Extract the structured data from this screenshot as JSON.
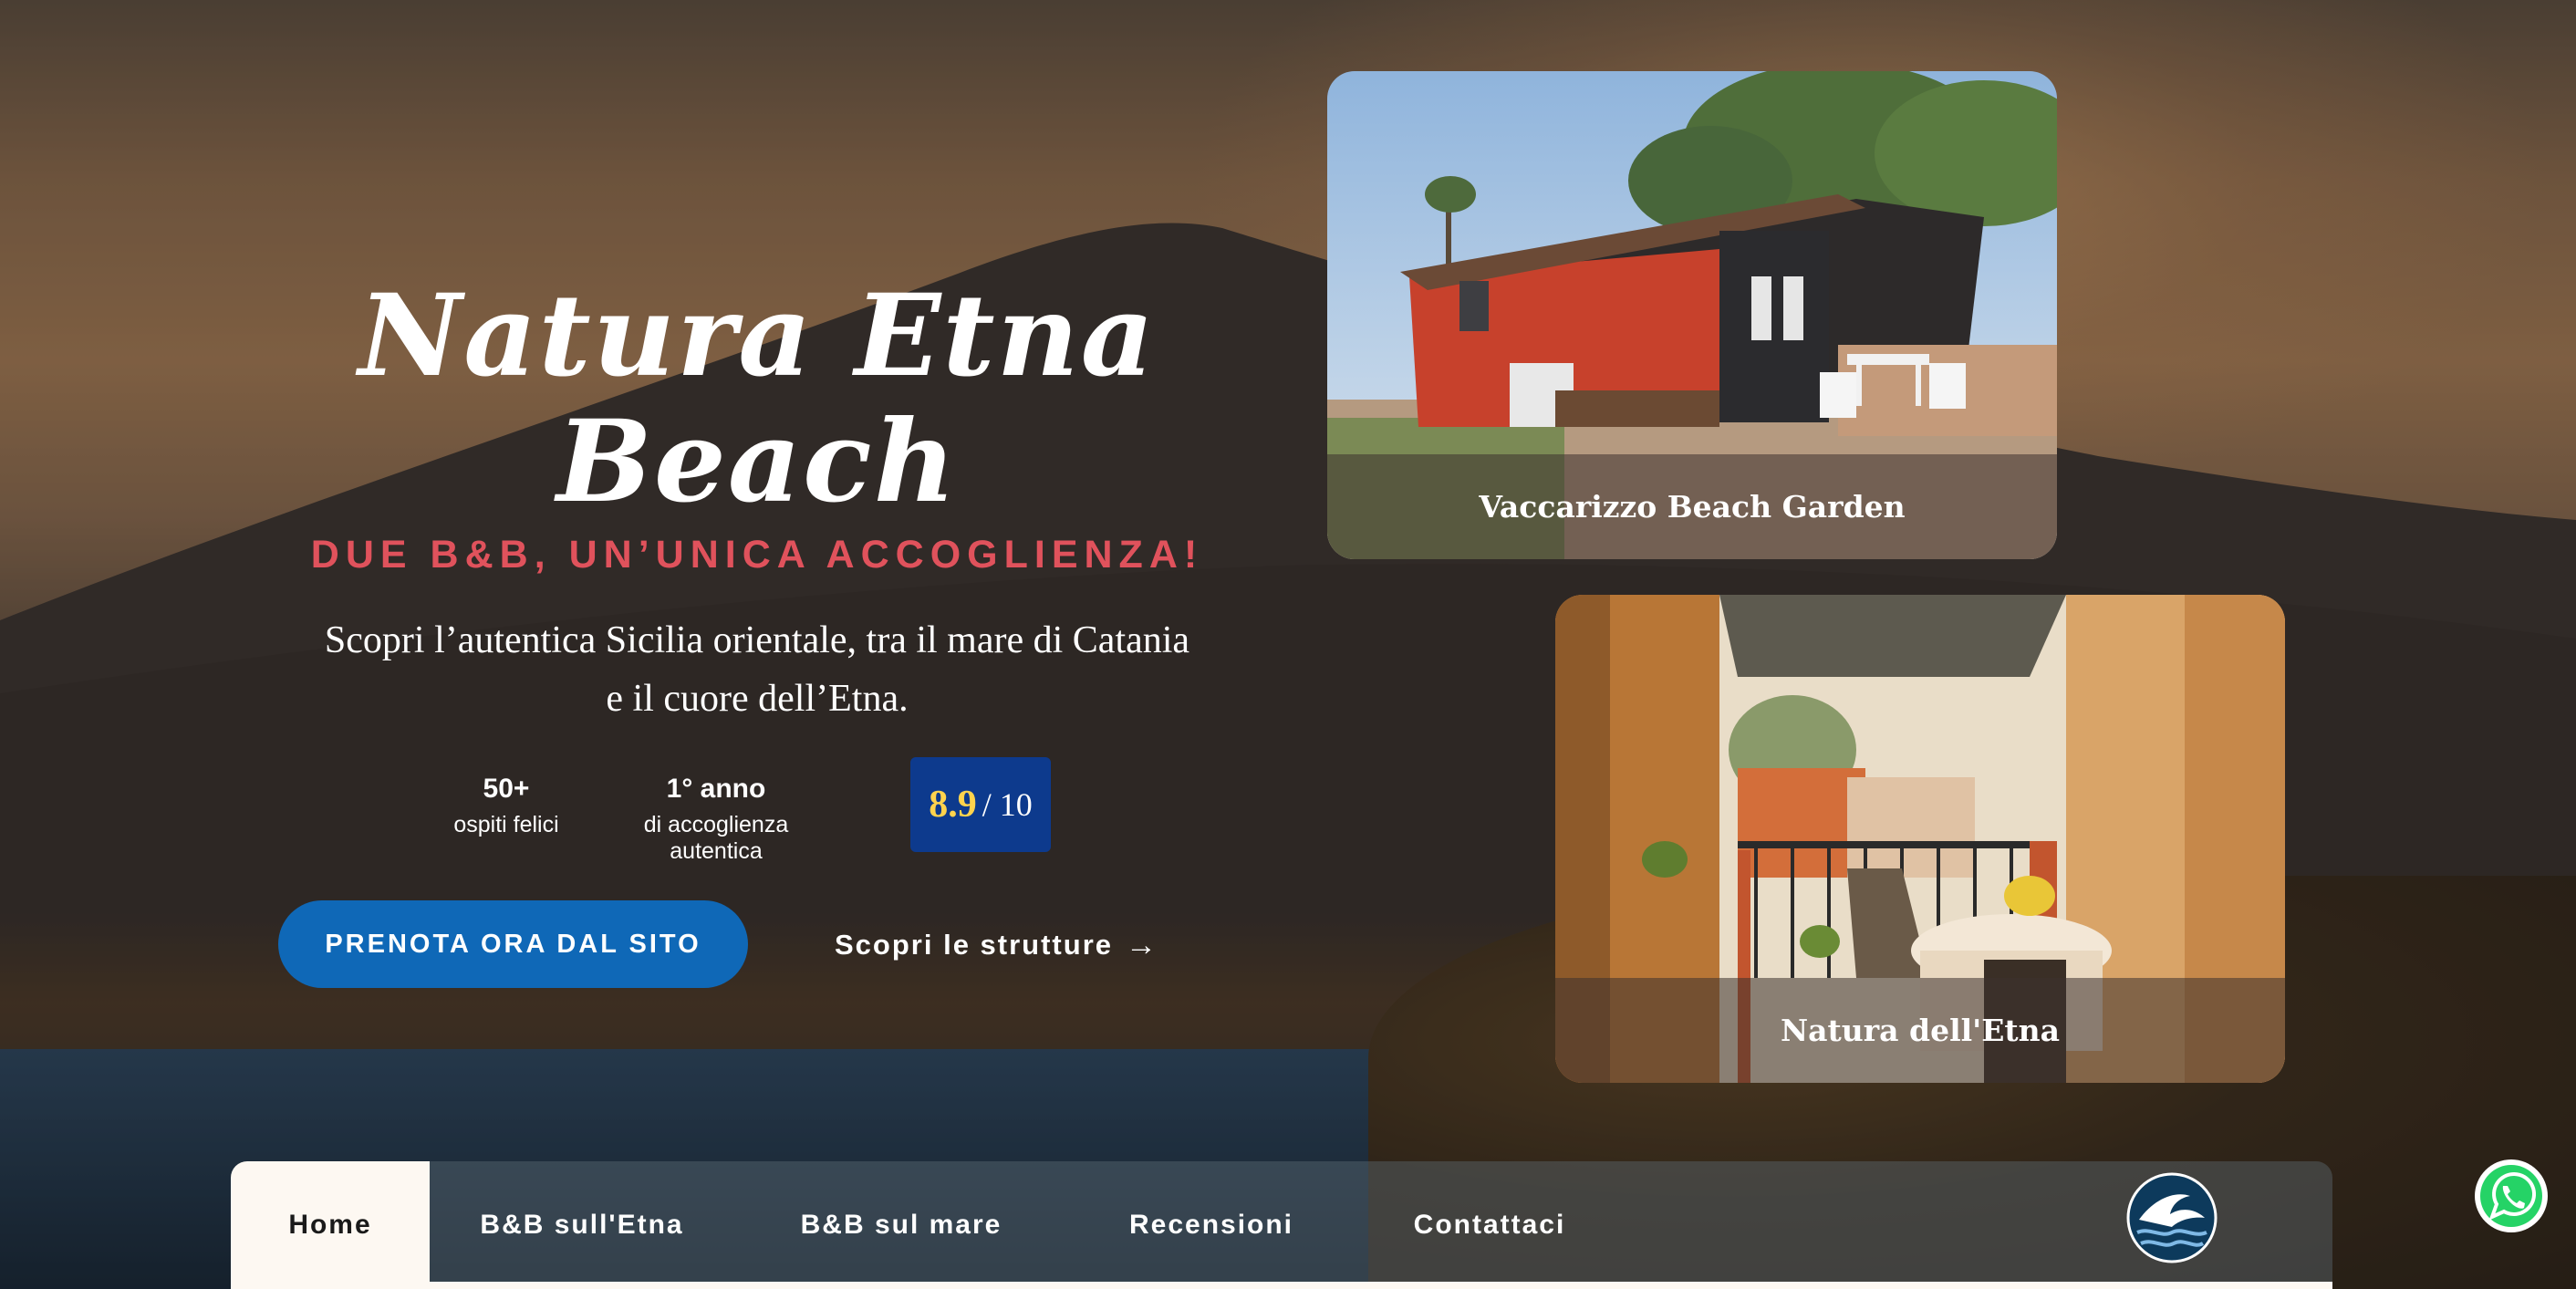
{
  "hero": {
    "title_line1": "Natura Etna",
    "title_line2": "Beach",
    "subtitle": "DUE B&B, UN’UNICA ACCOGLIENZA!",
    "description_line1": "Scopri l’autentica Sicilia orientale, tra il mare di Catania",
    "description_line2": "e il cuore dell’Etna.",
    "stats": [
      {
        "value": "50+",
        "label": "ospiti felici"
      },
      {
        "value": "1° anno",
        "label": "di accoglienza autentica"
      }
    ],
    "rating": {
      "score": "8.9",
      "scale": "/ 10"
    },
    "primary_button": "PRENOTA ORA DAL SITO",
    "secondary_link": "Scopri le strutture",
    "secondary_arrow": "→"
  },
  "cards": [
    {
      "caption": "Vaccarizzo Beach Garden"
    },
    {
      "caption": "Natura dell'Etna"
    }
  ],
  "nav": {
    "items": [
      {
        "label": "Home",
        "active": true
      },
      {
        "label": "B&B sull'Etna"
      },
      {
        "label": "B&B sul mare"
      },
      {
        "label": "Recensioni"
      },
      {
        "label": "Contattaci"
      }
    ]
  },
  "icons": {
    "logo": "wave-logo-icon",
    "chat": "whatsapp-icon"
  },
  "colors": {
    "accent_red": "#e0525c",
    "primary_blue": "#0f68b7",
    "rating_bg": "#0d3a8d",
    "rating_score": "#ffd34d",
    "nav_active_bg": "#fdf8f2",
    "whatsapp_green": "#25d366"
  }
}
